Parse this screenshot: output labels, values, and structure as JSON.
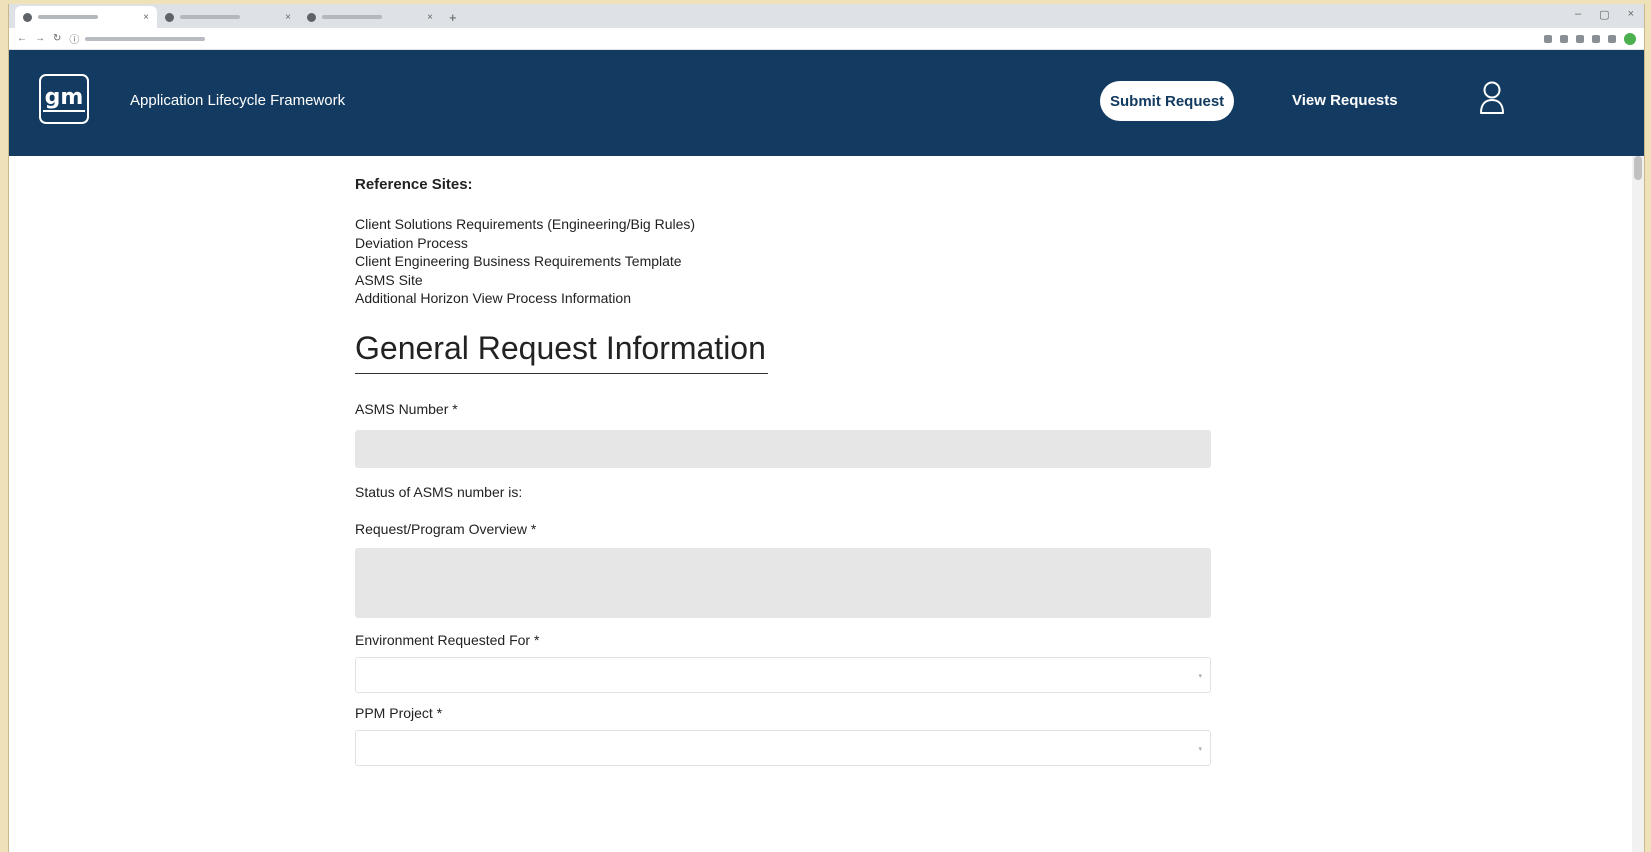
{
  "header": {
    "app_title": "Application Lifecycle Framework",
    "logo_text": "gm",
    "submit_label": "Submit Request",
    "view_label": "View Requests"
  },
  "reference": {
    "heading": "Reference Sites:",
    "links": [
      "Client Solutions Requirements (Engineering/Big Rules)",
      "Deviation Process",
      "Client Engineering Business Requirements Template",
      "ASMS Site",
      "Additional Horizon View Process Information"
    ]
  },
  "form": {
    "section_title": "General Request Information",
    "asms_label": "ASMS Number *",
    "asms_value": "",
    "asms_status": "Status of ASMS number is:",
    "overview_label": "Request/Program Overview *",
    "overview_value": "",
    "environment_label": "Environment Requested For *",
    "environment_value": "",
    "ppm_label": "PPM Project *",
    "ppm_value": ""
  },
  "colors": {
    "header_bg": "#133b61",
    "input_bg": "#e6e6e6",
    "frame_bg": "#efe2b8"
  },
  "icons": {
    "user": "user-icon",
    "select_caret": "chevron-down-icon"
  }
}
